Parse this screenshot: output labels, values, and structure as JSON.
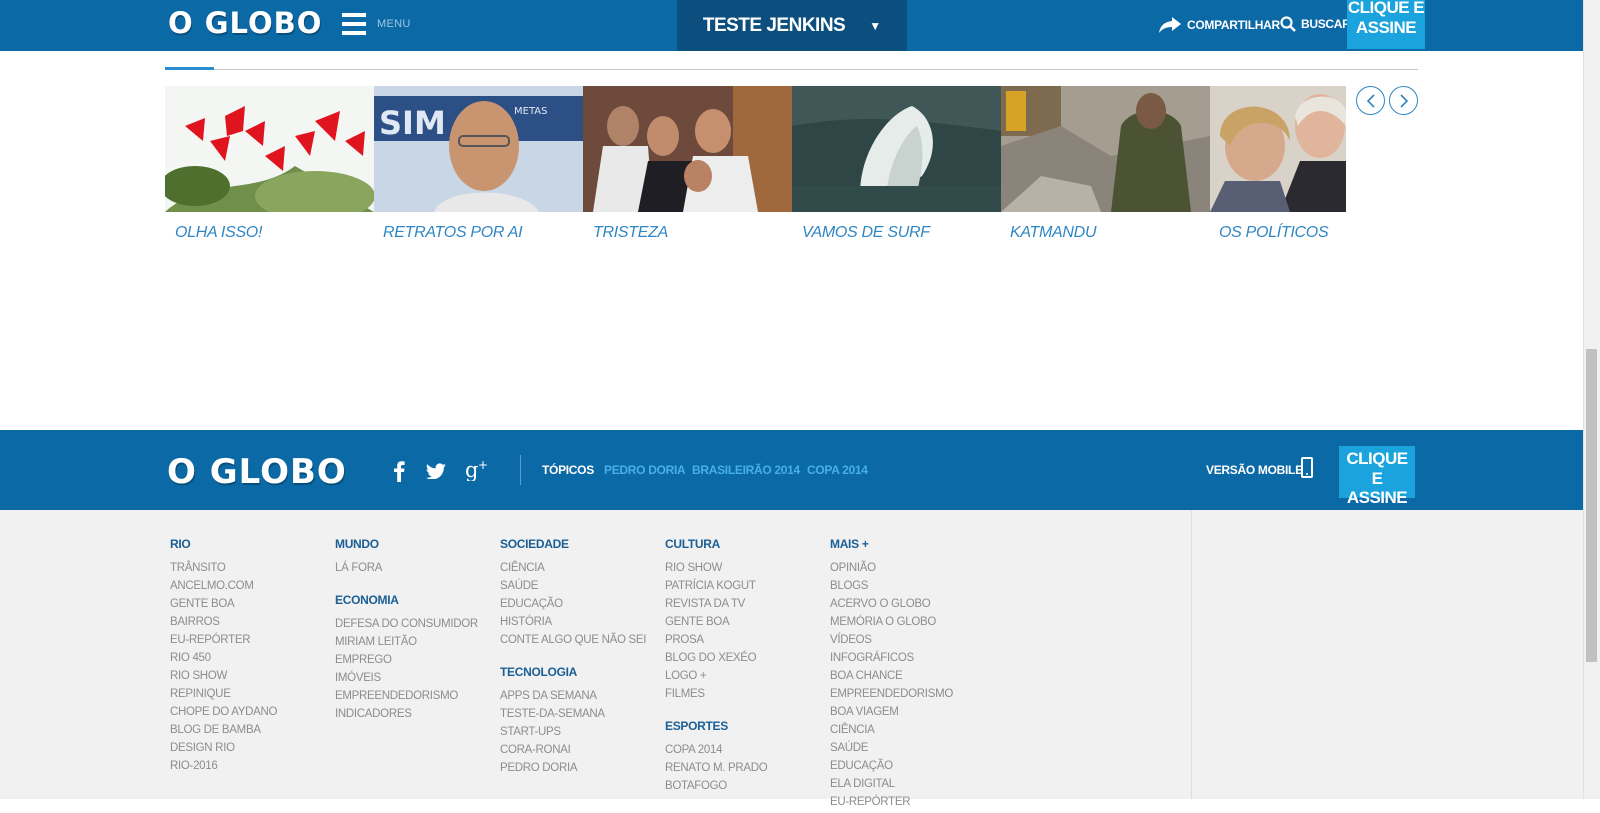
{
  "header": {
    "logo": "O GLOBO",
    "menu_label": "MENU",
    "section": "TESTE JENKINS",
    "share": "COMPARTILHAR",
    "search": "BUSCAR",
    "assine_line1": "CLIQUE E",
    "assine_line2": "ASSINE"
  },
  "gallery": {
    "items": [
      {
        "caption": "OLHA ISSO!"
      },
      {
        "caption": "RETRATOS POR AI"
      },
      {
        "caption": "TRISTEZA"
      },
      {
        "caption": "VAMOS DE SURF"
      },
      {
        "caption": "KATMANDU"
      },
      {
        "caption": "OS POLÍTICOS"
      }
    ]
  },
  "footer_band": {
    "logo": "O GLOBO",
    "topics_label": "TÓPICOS",
    "topics": [
      "PEDRO DORIA",
      "BRASILEIRÃO 2014",
      "COPA 2014"
    ],
    "mobile": "VERSÃO MOBILE",
    "assine_line1": "CLIQUE E",
    "assine_line2": "ASSINE"
  },
  "footer_links": {
    "rio": {
      "head": "RIO",
      "links": [
        "TRÂNSITO",
        "ANCELMO.COM",
        "GENTE BOA",
        "BAIRROS",
        "EU-REPÓRTER",
        "RIO 450",
        "RIO SHOW",
        "REPINIQUE",
        "CHOPE DO AYDANO",
        "BLOG DE BAMBA",
        "DESIGN RIO",
        "RIO-2016"
      ]
    },
    "mundo": {
      "head": "MUNDO",
      "links": [
        "LÁ FORA"
      ]
    },
    "economia": {
      "head": "ECONOMIA",
      "links": [
        "DEFESA DO CONSUMIDOR",
        "MIRIAM LEITÃO",
        "EMPREGO",
        "IMÓVEIS",
        "EMPREENDEDORISMO",
        "INDICADORES"
      ]
    },
    "sociedade": {
      "head": "SOCIEDADE",
      "links": [
        "CIÊNCIA",
        "SAÚDE",
        "EDUCAÇÃO",
        "HISTÓRIA",
        "CONTE ALGO QUE NÃO SEI"
      ]
    },
    "tecnologia": {
      "head": "TECNOLOGIA",
      "links": [
        "APPS DA SEMANA",
        "TESTE-DA-SEMANA",
        "START-UPS",
        "CORA-RONAI",
        "PEDRO DORIA"
      ]
    },
    "cultura": {
      "head": "CULTURA",
      "links": [
        "RIO SHOW",
        "PATRÍCIA KOGUT",
        "REVISTA DA TV",
        "GENTE BOA",
        "PROSA",
        "BLOG DO XEXÉO",
        "LOGO +",
        "FILMES"
      ]
    },
    "esportes": {
      "head": "ESPORTES",
      "links": [
        "COPA 2014",
        "RENATO M. PRADO",
        "BOTAFOGO"
      ]
    },
    "mais": {
      "head": "MAIS +",
      "links": [
        "OPINIÃO",
        "BLOGS",
        "ACERVO O GLOBO",
        "MEMÓRIA O GLOBO",
        "VÍDEOS",
        "INFOGRÁFICOS",
        "BOA CHANCE",
        "EMPREENDEDORISMO",
        "BOA VIAGEM",
        "CIÊNCIA",
        "SAÚDE",
        "EDUCAÇÃO",
        "ELA DIGITAL",
        "EU-REPÓRTER"
      ]
    }
  },
  "colors": {
    "brand_blue": "#0b69a6",
    "dark_blue": "#0c4f7e",
    "accent": "#1aa3dc",
    "link_blue": "#2f86c4"
  }
}
